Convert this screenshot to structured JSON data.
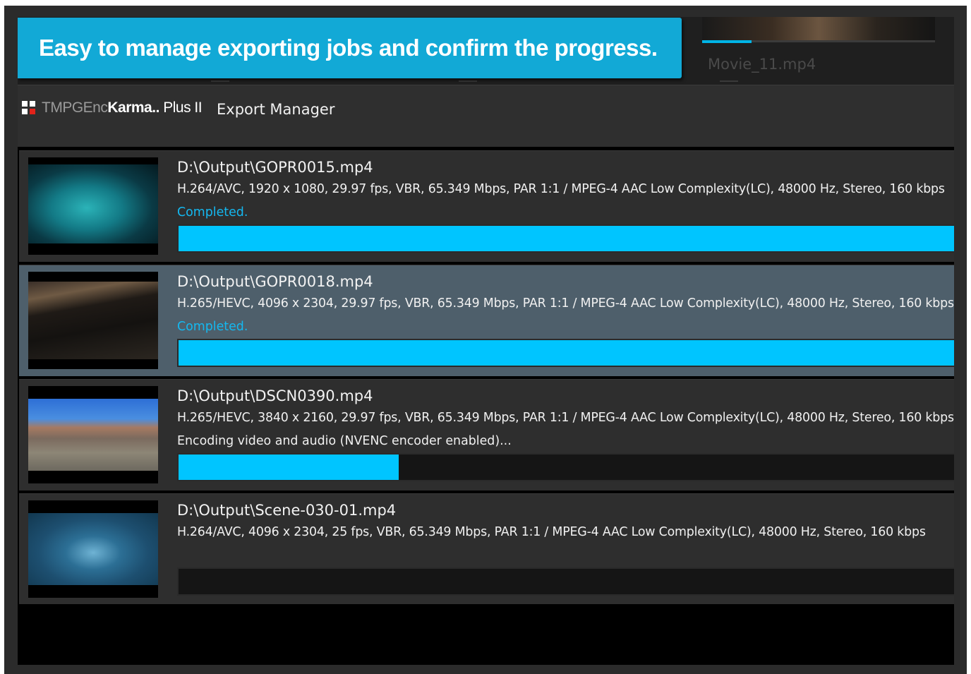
{
  "banner": {
    "text": "Easy to manage exporting jobs and confirm the progress."
  },
  "background": {
    "filename": "Movie_11.mp4"
  },
  "app": {
    "logo_part1": "TMPGEnc",
    "logo_part2": "Karma..",
    "logo_part3": "Plus II",
    "window_title": "Export Manager"
  },
  "colors": {
    "accent": "#00c5ff",
    "banner": "#12a9d6",
    "completed_text": "#14b8f0",
    "logo_red": "#e2231a"
  },
  "jobs": [
    {
      "path": "D:\\Output\\GOPR0015.mp4",
      "spec": "H.264/AVC, 1920 x 1080, 29.97 fps, VBR, 65.349 Mbps, PAR 1:1 / MPEG-4 AAC Low Complexity(LC), 48000 Hz, Stereo, 160 kbps",
      "status": "Completed.",
      "progress": 1.0,
      "thumbnail": "underwater-pool-scene"
    },
    {
      "path": "D:\\Output\\GOPR0018.mp4",
      "spec": "H.265/HEVC, 4096 x 2304, 29.97 fps, VBR, 65.349 Mbps, PAR 1:1 / MPEG-4 AAC Low Complexity(LC), 48000 Hz, Stereo, 160 kbps",
      "status": "Completed.",
      "progress": 1.0,
      "thumbnail": "night-ground-scene"
    },
    {
      "path": "D:\\Output\\DSCN0390.mp4",
      "spec": "H.265/HEVC, 3840 x 2160, 29.97 fps, VBR, 65.349 Mbps, PAR 1:1 / MPEG-4 AAC Low Complexity(LC), 48000 Hz, Stereo, 160 kbps",
      "status": "Encoding video and audio (NVENC encoder enabled)...",
      "progress": 0.28,
      "thumbnail": "desert-mountain-scene"
    },
    {
      "path": "D:\\Output\\Scene-030-01.mp4",
      "spec": "H.264/AVC, 4096 x 2304, 25 fps, VBR, 65.349 Mbps, PAR 1:1 / MPEG-4 AAC Low Complexity(LC), 48000 Hz, Stereo, 160 kbps",
      "status": "",
      "progress": 0.0,
      "thumbnail": "underwater-diver-scene"
    }
  ]
}
